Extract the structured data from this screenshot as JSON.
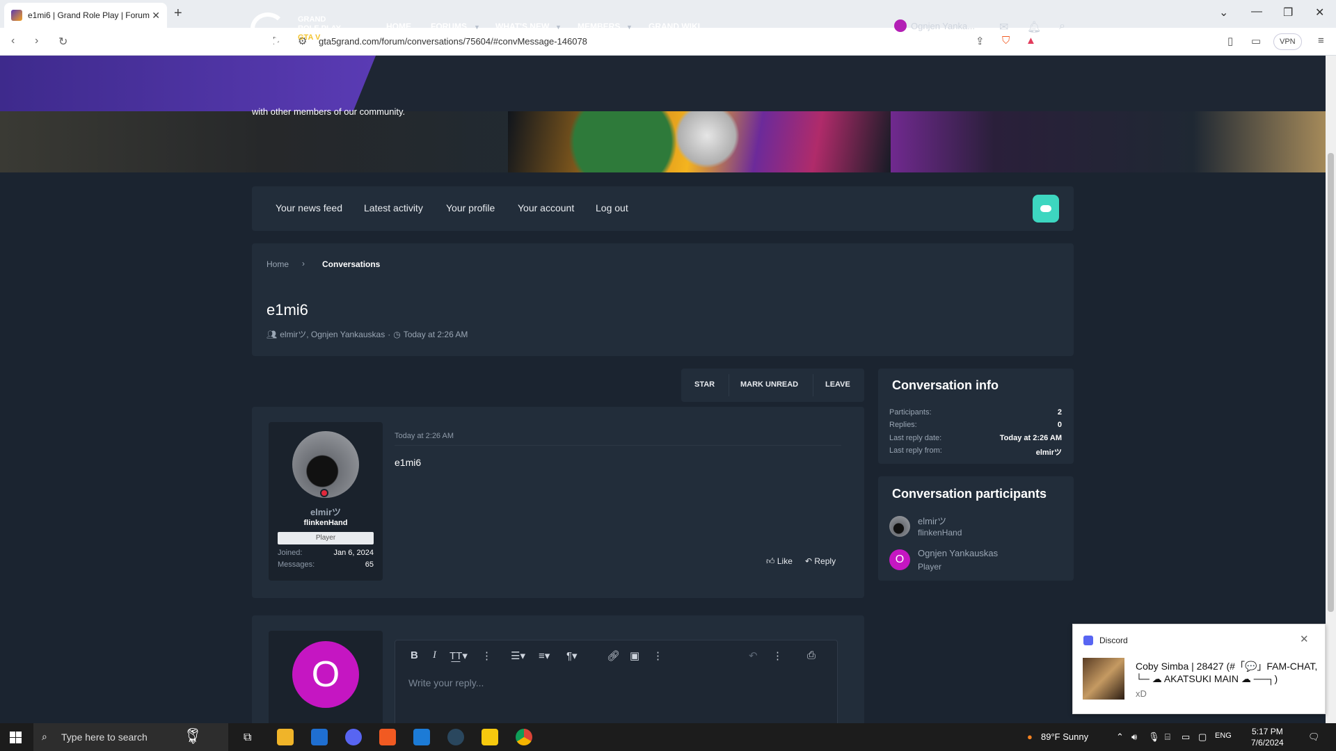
{
  "browser": {
    "tab_title": "e1mi6 | Grand Role Play | Forum",
    "url": "gta5grand.com/forum/conversations/75604/#convMessage-146078",
    "vpn_label": "VPN"
  },
  "site": {
    "logo_line1": "GRAND",
    "logo_line2": "ROLE PLAY",
    "logo_line3": "GTA V",
    "nav": [
      "HOME",
      "FORUMS",
      "WHAT'S NEW",
      "MEMBERS",
      "GRAND WIKI"
    ],
    "username": "Ognjen Yanka...",
    "banner_text": "with other members of our community.",
    "accent_purple": "#5a3bb4",
    "accent_teal": "#3dd6c0"
  },
  "account_tabs": [
    "Your news feed",
    "Latest activity",
    "Your profile",
    "Your account",
    "Log out"
  ],
  "breadcrumb": {
    "home": "Home",
    "current": "Conversations"
  },
  "conversation": {
    "title": "e1mi6",
    "participants_text": "elmirツ, Ognjen Yankauskas",
    "separator": "·",
    "date": "Today at 2:26 AM"
  },
  "actions": [
    "STAR",
    "MARK UNREAD",
    "LEAVE"
  ],
  "message": {
    "author": "elmirツ",
    "title": "flinkenHand",
    "rank": "Player",
    "joined_label": "Joined:",
    "joined_value": "Jan 6, 2024",
    "messages_label": "Messages:",
    "messages_value": "65",
    "time": "Today at 2:26 AM",
    "body": "e1mi6",
    "like_label": "Like",
    "reply_label": "Reply"
  },
  "conversation_info": {
    "heading": "Conversation info",
    "rows": [
      {
        "label": "Participants:",
        "value": "2"
      },
      {
        "label": "Replies:",
        "value": "0"
      },
      {
        "label": "Last reply date:",
        "value": "Today at 2:26 AM"
      },
      {
        "label": "Last reply from:",
        "value": "elmirツ"
      }
    ]
  },
  "participants": {
    "heading": "Conversation participants",
    "list": [
      {
        "name": "elmirツ",
        "title": "flinkenHand",
        "avatar_letter": ""
      },
      {
        "name": "Ognjen Yankauskas",
        "title": "Player",
        "avatar_letter": "O"
      }
    ]
  },
  "reply": {
    "avatar_letter": "O",
    "placeholder": "Write your reply..."
  },
  "toast": {
    "app": "Discord",
    "header": "Coby Simba | 28427 (#「💬」FAM-CHAT,",
    "line2": "└─ ☁ AKATSUKI MAIN ☁ ──┐)",
    "body": "xD"
  },
  "taskbar": {
    "search_placeholder": "Type here to search",
    "weather": "89°F  Sunny",
    "lang": "ENG",
    "time": "5:17 PM",
    "date": "7/6/2024"
  }
}
